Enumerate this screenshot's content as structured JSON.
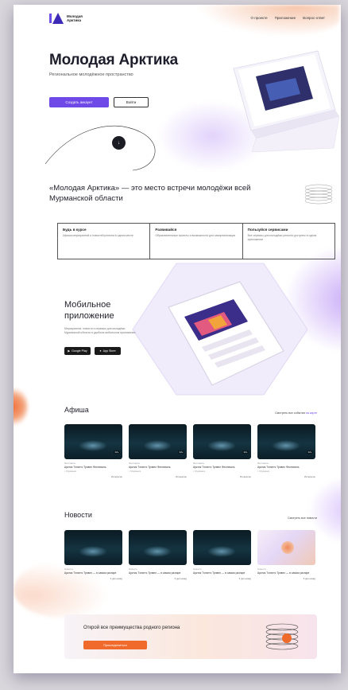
{
  "header": {
    "logo_text": "Молодая Арктика",
    "nav": [
      "О проекте",
      "Приложение",
      "Вопрос-ответ"
    ]
  },
  "hero": {
    "title": "Молодая Арктика",
    "subtitle": "Региональное молодёжное пространство",
    "primary_button": "Создать аккаунт",
    "secondary_button": "Войти",
    "scroll_icon": "arrow-down-icon"
  },
  "about": {
    "title": "«Молодая Арктика» — это место встречи молодёжи всей Мурманской области",
    "features": [
      {
        "title": "Будь в курсе",
        "text": "Афиша мероприятий и новостей региона в одном месте"
      },
      {
        "title": "Развивайся",
        "text": "Образовательные проекты и возможности для самореализации"
      },
      {
        "title": "Пользуйся сервисами",
        "text": "Все сервисы для молодёжи региона доступны в одном приложении"
      }
    ]
  },
  "mobile": {
    "title": "Мобильное приложение",
    "description": "Мероприятия, новости и сервисы для молодёжи Мурманской области в удобном мобильном приложении",
    "stores": [
      "Google Play",
      "App Store"
    ]
  },
  "afisha": {
    "title": "Афиша",
    "link_prefix": "Смотреть все события",
    "link_accent": "на карте",
    "events": [
      {
        "tag": "12+",
        "meta": "Фестиваль",
        "title": "Арктик Тэлэнтс Трэвел Фестиваль",
        "place": "г. Мурманск",
        "foot": "Интересно"
      },
      {
        "tag": "12+",
        "meta": "Фестиваль",
        "title": "Арктик Тэлэнтс Трэвел Фестиваль",
        "place": "г. Мурманск",
        "foot": "Интересно"
      },
      {
        "tag": "12+",
        "meta": "Фестиваль",
        "title": "Арктик Тэлэнтс Трэвел Фестиваль",
        "place": "г. Мурманск",
        "foot": "Интересно"
      },
      {
        "tag": "12+",
        "meta": "Фестиваль",
        "title": "Арктик Тэлэнтс Трэвел Фестиваль",
        "place": "г. Мурманск",
        "foot": "Интересно"
      }
    ]
  },
  "news": {
    "title": "Новости",
    "link": "Смотреть все новости",
    "items": [
      {
        "meta": "Новости",
        "title": "Арктик Тэлэнтс Трэвел — в самом разгаре",
        "foot": "3 дня назад"
      },
      {
        "meta": "Новости",
        "title": "Арктик Тэлэнтс Трэвел — в самом разгаре",
        "foot": "3 дня назад"
      },
      {
        "meta": "Новости",
        "title": "Арктик Тэлэнтс Трэвел — в самом разгаре",
        "foot": "3 дня назад"
      },
      {
        "meta": "Новости",
        "title": "Арктик Тэлэнтс Трэвел — в самом разгаре",
        "foot": "3 дня назад"
      }
    ]
  },
  "banner": {
    "text": "Открой все преимущества родного региона",
    "button": "Присоединиться"
  },
  "colors": {
    "accent": "#6f48e8",
    "orange": "#ef6a2b",
    "dark": "#1d1d2b"
  }
}
